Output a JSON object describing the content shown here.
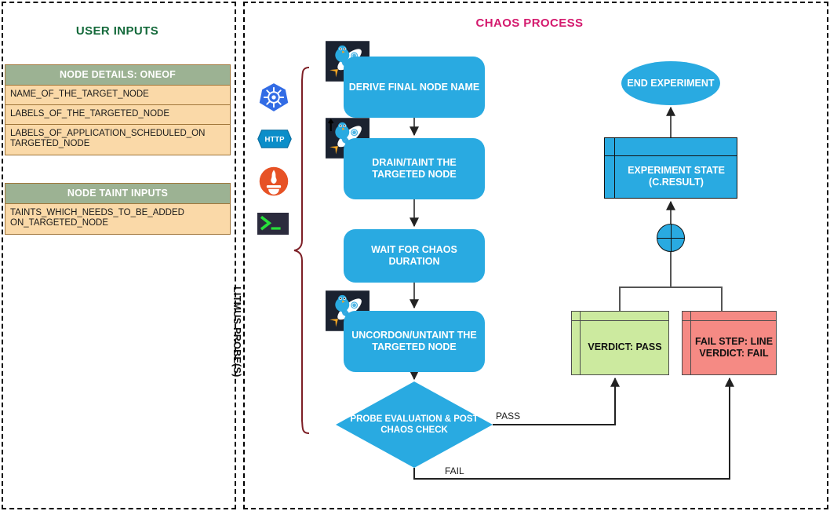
{
  "panels": {
    "user_inputs": {
      "title": "USER INPUTS",
      "tables": [
        {
          "header": "NODE DETAILS: ONEOF",
          "rows": [
            "NAME_OF_THE_TARGET_NODE",
            "LABELS_OF_THE_TARGETED_NODE",
            "LABELS_OF_APPLICATION_SCHEDULED_ON TARGETED_NODE"
          ]
        },
        {
          "header": "NODE TAINT INPUTS",
          "rows": [
            "TAINTS_WHICH_NEEDS_TO_BE_ADDED ON_TARGETED_NODE"
          ]
        }
      ]
    },
    "chaos_process": {
      "title": "CHAOS PROCESS",
      "litmus_bracket_label": "LITMUS PROBE(S)",
      "probe_icons": [
        {
          "name": "kubernetes-icon",
          "label": "Kubernetes probe"
        },
        {
          "name": "http-icon",
          "label": "HTTP"
        },
        {
          "name": "prometheus-icon",
          "label": "Prometheus probe"
        },
        {
          "name": "cmd-terminal-icon",
          "label": "Command probe"
        }
      ],
      "steps": [
        {
          "id": "derive",
          "label": "DERIVE FINAL NODE NAME",
          "icon": "litmus-rocket-icon"
        },
        {
          "id": "drain",
          "label": "DRAIN/TAINT THE TARGETED NODE",
          "icon": "litmus-rocket-icon"
        },
        {
          "id": "wait",
          "label": "WAIT FOR CHAOS DURATION",
          "icon": null
        },
        {
          "id": "uncordon",
          "label": "UNCORDON/UNTAINT THE TARGETED NODE",
          "icon": "litmus-rocket-icon"
        }
      ],
      "decision": {
        "label": "PROBE EVALUATION & POST CHAOS CHECK",
        "branches": {
          "pass": "PASS",
          "fail": "FAIL"
        }
      },
      "verdicts": {
        "pass": "VERDICT: PASS",
        "fail": "FAIL STEP: LINE VERDICT: FAIL"
      },
      "experiment_state": "EXPERIMENT STATE (C.RESULT)",
      "end": "END EXPERIMENT"
    }
  },
  "colors": {
    "title_green": "#13693a",
    "title_pink": "#d41a6e",
    "flow_blue": "#29aae1",
    "table_header_green": "#9cb293",
    "table_row_peach": "#fad9a8",
    "table_border_brown": "#a0763a",
    "verdict_pass_green": "#ccea9f",
    "verdict_fail_red": "#f58a84",
    "bracket_maroon": "#7d1f26"
  }
}
